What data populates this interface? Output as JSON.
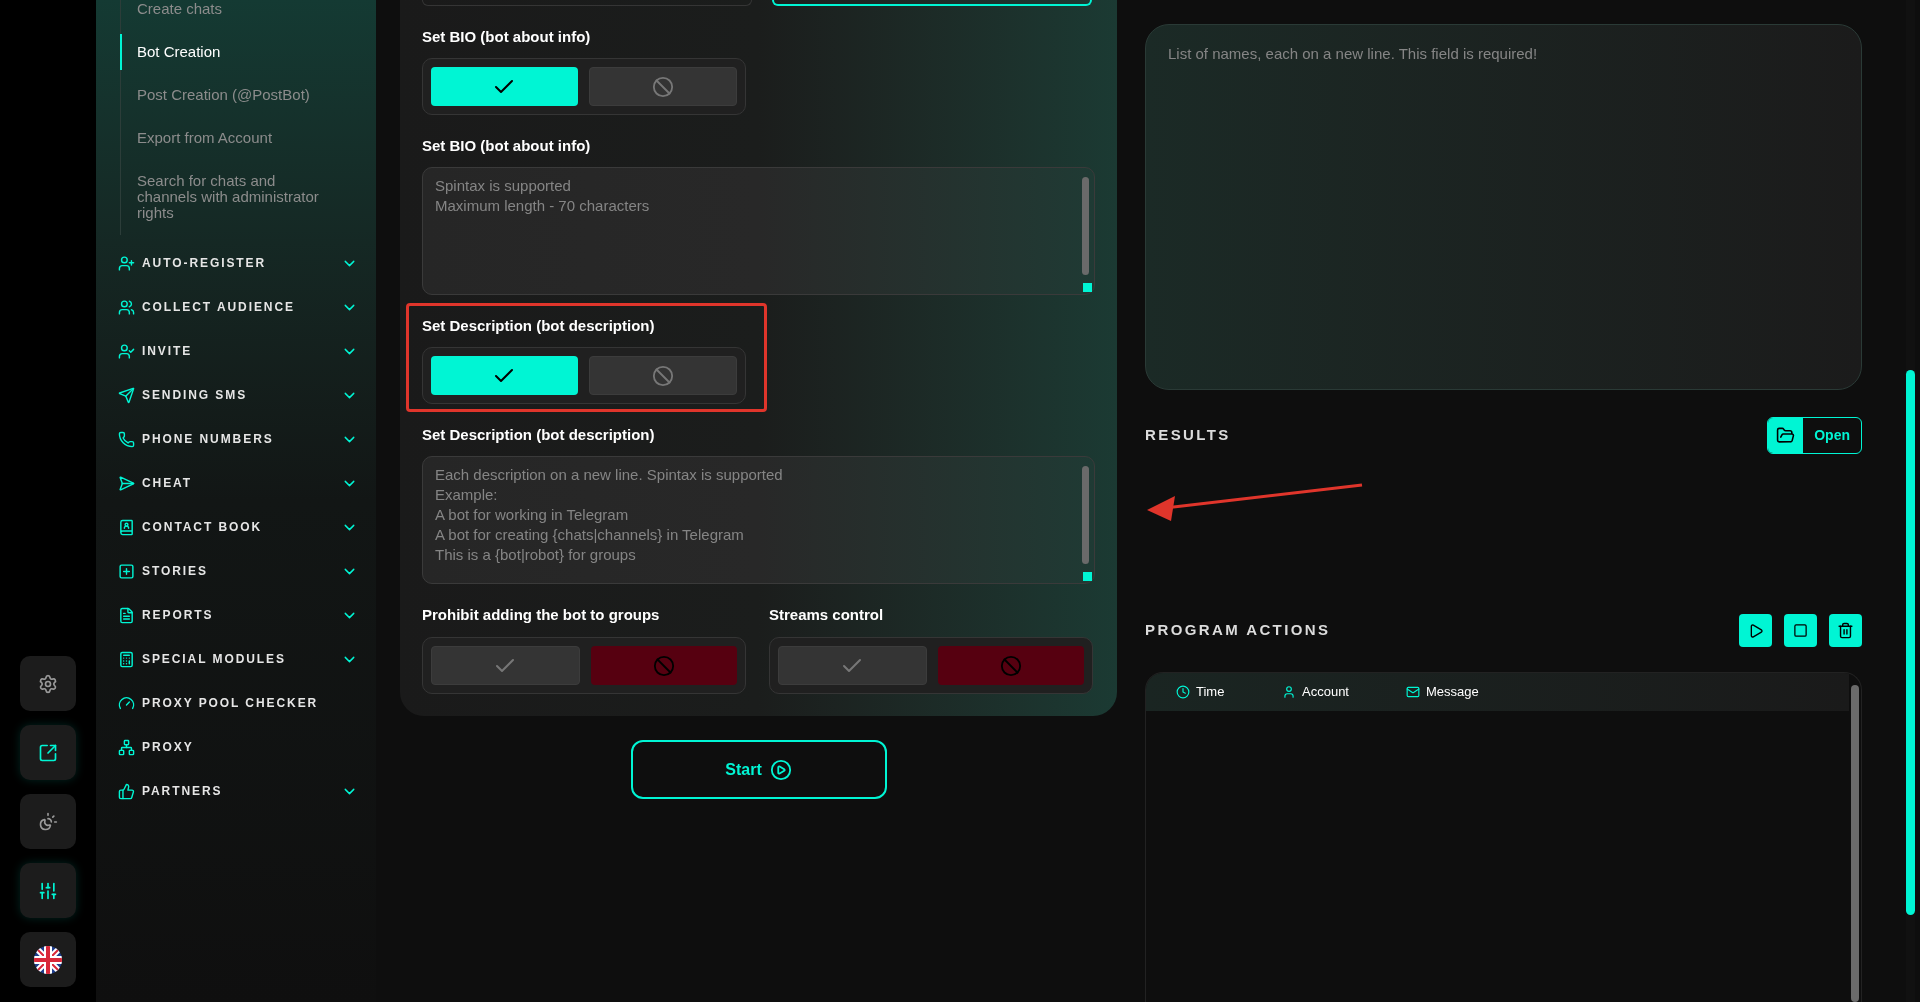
{
  "rail": [
    {
      "kind": "settings",
      "active": false
    },
    {
      "kind": "export",
      "active": true
    },
    {
      "kind": "theme",
      "active": false
    },
    {
      "kind": "filters",
      "active": true
    },
    {
      "kind": "language",
      "active": false
    }
  ],
  "sidebar": {
    "submenu": [
      {
        "label": "Create chats",
        "selected": false
      },
      {
        "label": "Bot Creation",
        "selected": true
      },
      {
        "label": "Post Creation (@PostBot)",
        "selected": false
      },
      {
        "label": "Export from Account",
        "selected": false
      },
      {
        "label": "Search for chats and channels with administrator rights",
        "selected": false
      }
    ],
    "menu": [
      {
        "label": "AUTO-REGISTER",
        "expandable": true
      },
      {
        "label": "COLLECT AUDIENCE",
        "expandable": true
      },
      {
        "label": "INVITE",
        "expandable": true
      },
      {
        "label": "SENDING SMS",
        "expandable": true
      },
      {
        "label": "PHONE NUMBERS",
        "expandable": true
      },
      {
        "label": "CHEAT",
        "expandable": true
      },
      {
        "label": "CONTACT BOOK",
        "expandable": true
      },
      {
        "label": "STORIES",
        "expandable": true
      },
      {
        "label": "REPORTS",
        "expandable": true
      },
      {
        "label": "SPECIAL MODULES",
        "expandable": true
      },
      {
        "label": "PROXY POOL CHECKER",
        "expandable": false
      },
      {
        "label": "PROXY",
        "expandable": false
      },
      {
        "label": "PARTNERS",
        "expandable": true
      }
    ]
  },
  "form": {
    "fields": [
      {
        "kind": "toggle",
        "label": "Set BIO (bot about info)",
        "enabled": true
      },
      {
        "kind": "textarea",
        "label": "Set BIO (bot about info)",
        "placeholder": "Spintax is supported\nMaximum length - 70 characters"
      },
      {
        "kind": "toggle",
        "label": "Set Description (bot description)",
        "enabled": true,
        "highlighted": true
      },
      {
        "kind": "textarea",
        "label": "Set Description (bot description)",
        "placeholder": "Each description on a new line. Spintax is supported\nExample:\nA bot for working in Telegram\nA bot for creating {chats|channels} in Telegram\nThis is a {bot|robot} for groups"
      }
    ],
    "options": [
      {
        "label": "Prohibit adding the bot to groups",
        "enabled": false
      },
      {
        "label": "Streams control",
        "enabled": false
      }
    ],
    "start_button": "Start"
  },
  "names_field": {
    "placeholder": "List of names, each on a new line. This field is required!"
  },
  "results": {
    "title": "RESULTS",
    "open_button": "Open"
  },
  "program_actions": {
    "title": "PROGRAM ACTIONS",
    "columns": [
      "Time",
      "Account",
      "Message"
    ]
  }
}
